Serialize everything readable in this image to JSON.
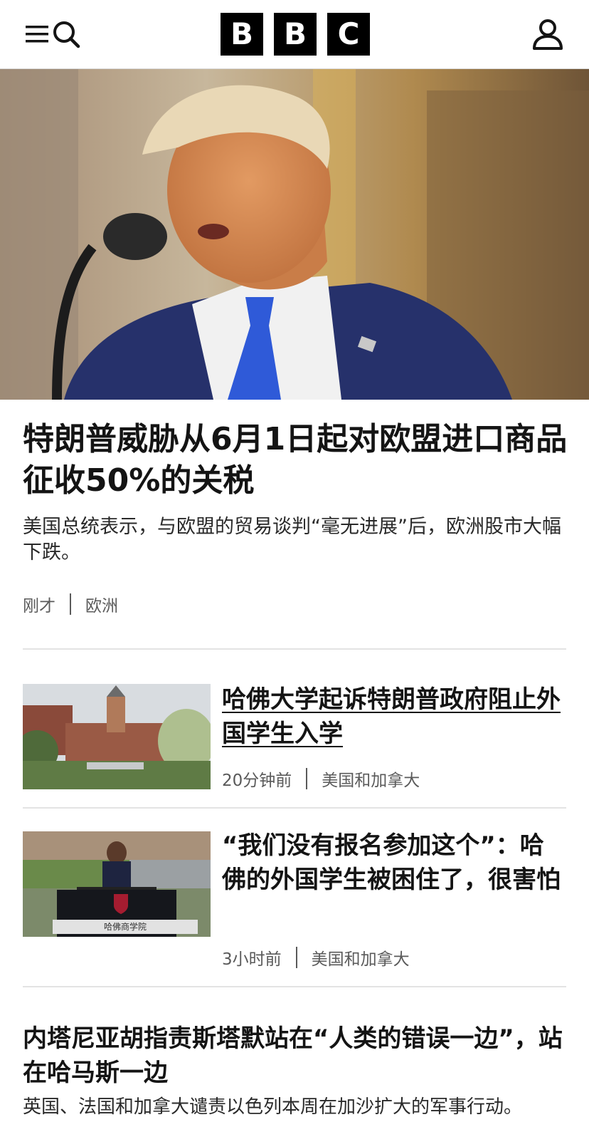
{
  "header": {
    "logo_letters": [
      "B",
      "B",
      "C"
    ],
    "menu_icon": "menu-icon",
    "search_icon": "search-icon",
    "account_icon": "account-icon"
  },
  "lead": {
    "title": "特朗普威胁从6月1日起对欧盟进口商品征收50%的关税",
    "summary": "美国总统表示，与欧盟的贸易谈判“毫无进展”后，欧洲股市大幅下跌。",
    "time": "刚才",
    "section": "欧洲"
  },
  "stories": [
    {
      "title": "哈佛大学起诉特朗普政府阻止外国学生入学",
      "time": "20分钟前",
      "section": "美国和加拿大"
    },
    {
      "title": "“我们没有报名参加这个”：哈佛的外国学生被困住了，很害怕",
      "time": "3小时前",
      "section": "美国和加拿大",
      "image_caption": "哈佛商学院"
    }
  ],
  "bottom_story": {
    "title": "内塔尼亚胡指责斯塔默站在“人类的错误一边”，站在哈马斯一边",
    "summary": "英国、法国和加拿大谴责以色列本周在加沙扩大的军事行动。"
  },
  "colors": {
    "logo_bg": "#000000",
    "text": "#141414",
    "meta": "#5a5a5a",
    "divider": "#e3e3e3"
  }
}
